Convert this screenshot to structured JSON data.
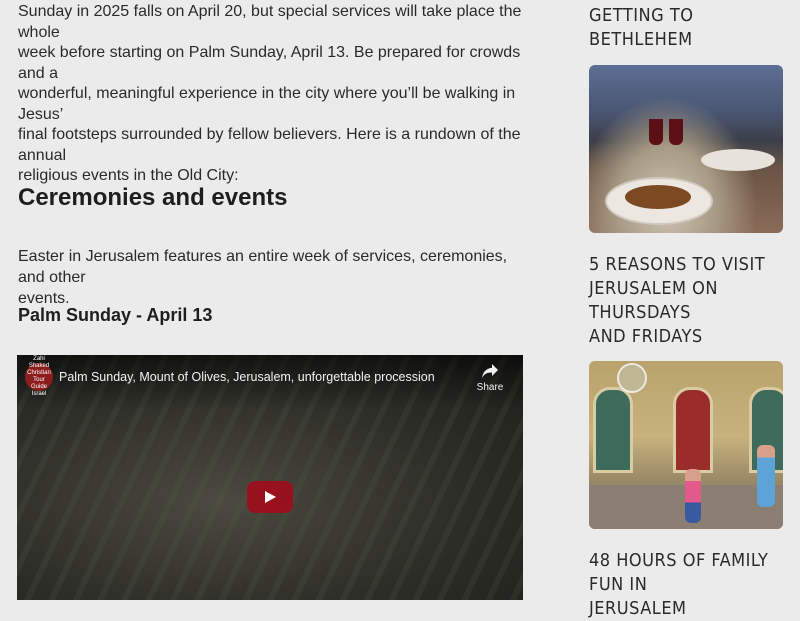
{
  "article": {
    "intro_lines": [
      "Sunday in 2025 falls on April 20, but special services will take place the whole",
      "week before starting on Palm Sunday, April 13. Be prepared for crowds and a",
      "wonderful, meaningful experience in the city where you’ll be walking in Jesus’",
      "final footsteps surrounded by fellow believers. Here is a rundown of the annual",
      "religious events in the Old City:"
    ],
    "section_heading": "Ceremonies and events",
    "section_paragraph_lines": [
      "Easter in Jerusalem features an entire week of services, ceremonies, and other",
      "events."
    ],
    "subheading": "Palm Sunday - April 13",
    "video": {
      "title": "Palm Sunday, Mount of Olives, Jerusalem, unforgettable procession",
      "channel_badge_lines": [
        "Zahi",
        "Shaked",
        "Christian",
        "Tour Guide",
        "Israel"
      ],
      "share_label": "Share"
    }
  },
  "sidebar": {
    "items": [
      {
        "title": "GETTING TO BETHLEHEM"
      },
      {
        "title_lines": [
          "5 REASONS TO VISIT",
          "JERUSALEM ON THURSDAYS",
          "AND FRIDAYS"
        ]
      },
      {
        "title_lines": [
          "48 HOURS OF FAMILY FUN IN",
          "JERUSALEM"
        ]
      }
    ]
  },
  "colors": {
    "background": "#ebebeb",
    "play_button": "#c00014"
  }
}
